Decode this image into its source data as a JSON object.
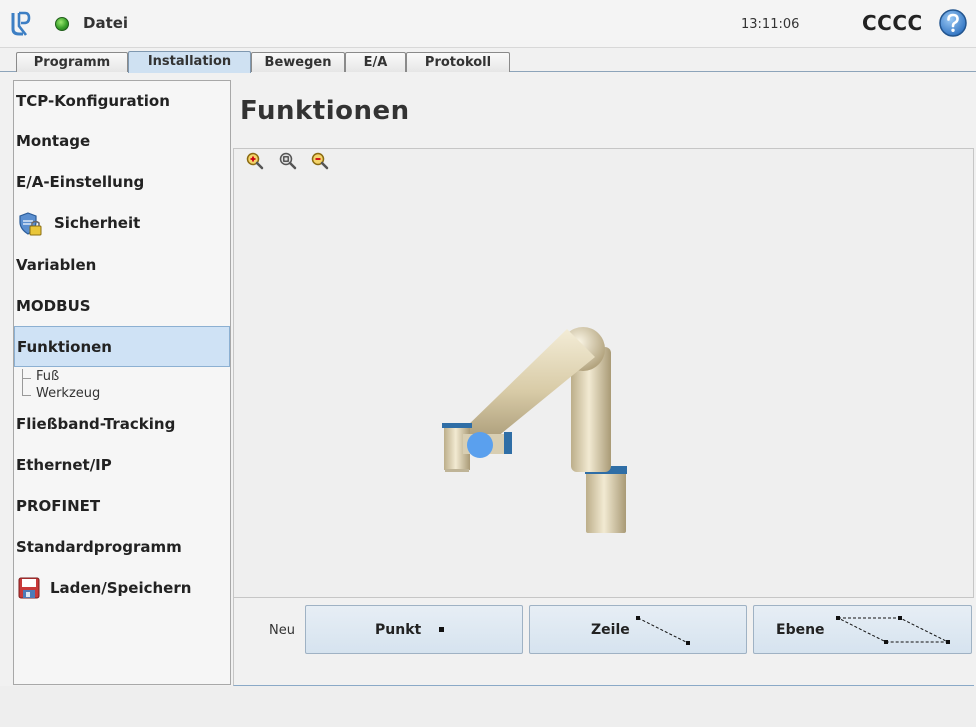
{
  "header": {
    "file_menu": "Datei",
    "clock": "13:11:06",
    "robot_name": "CCCC"
  },
  "tabs": [
    {
      "label": "Programm",
      "active": false
    },
    {
      "label": "Installation",
      "active": true
    },
    {
      "label": "Bewegen",
      "active": false
    },
    {
      "label": "E/A",
      "active": false
    },
    {
      "label": "Protokoll",
      "active": false
    }
  ],
  "sidebar": {
    "items": [
      {
        "label": "TCP-Konfiguration"
      },
      {
        "label": "Montage"
      },
      {
        "label": "E/A-Einstellung"
      },
      {
        "label": "Sicherheit",
        "icon": "shield-lock-icon"
      },
      {
        "label": "Variablen"
      },
      {
        "label": "MODBUS"
      },
      {
        "label": "Funktionen",
        "active": true
      },
      {
        "label": "Fließband-Tracking"
      },
      {
        "label": "Ethernet/IP"
      },
      {
        "label": "PROFINET"
      },
      {
        "label": "Standardprogramm"
      },
      {
        "label": "Laden/Speichern",
        "icon": "floppy-disk-icon"
      }
    ],
    "sub_items": [
      {
        "label": "Fuß"
      },
      {
        "label": "Werkzeug"
      }
    ]
  },
  "main": {
    "title": "Funktionen",
    "zoom_icons": [
      "zoom-in-icon",
      "zoom-reset-icon",
      "zoom-out-icon"
    ],
    "new_label": "Neu",
    "buttons": [
      {
        "label": "Punkt",
        "icon": "point-icon"
      },
      {
        "label": "Zeile",
        "icon": "line-icon"
      },
      {
        "label": "Ebene",
        "icon": "plane-icon"
      }
    ]
  },
  "colors": {
    "active_tab": "#cfe1f2",
    "active_item": "#cfe2f5",
    "button_bg": "#dce7f1",
    "robot_joint_blue": "#2f6ea6",
    "tcp_marker": "#5aa0ee"
  }
}
